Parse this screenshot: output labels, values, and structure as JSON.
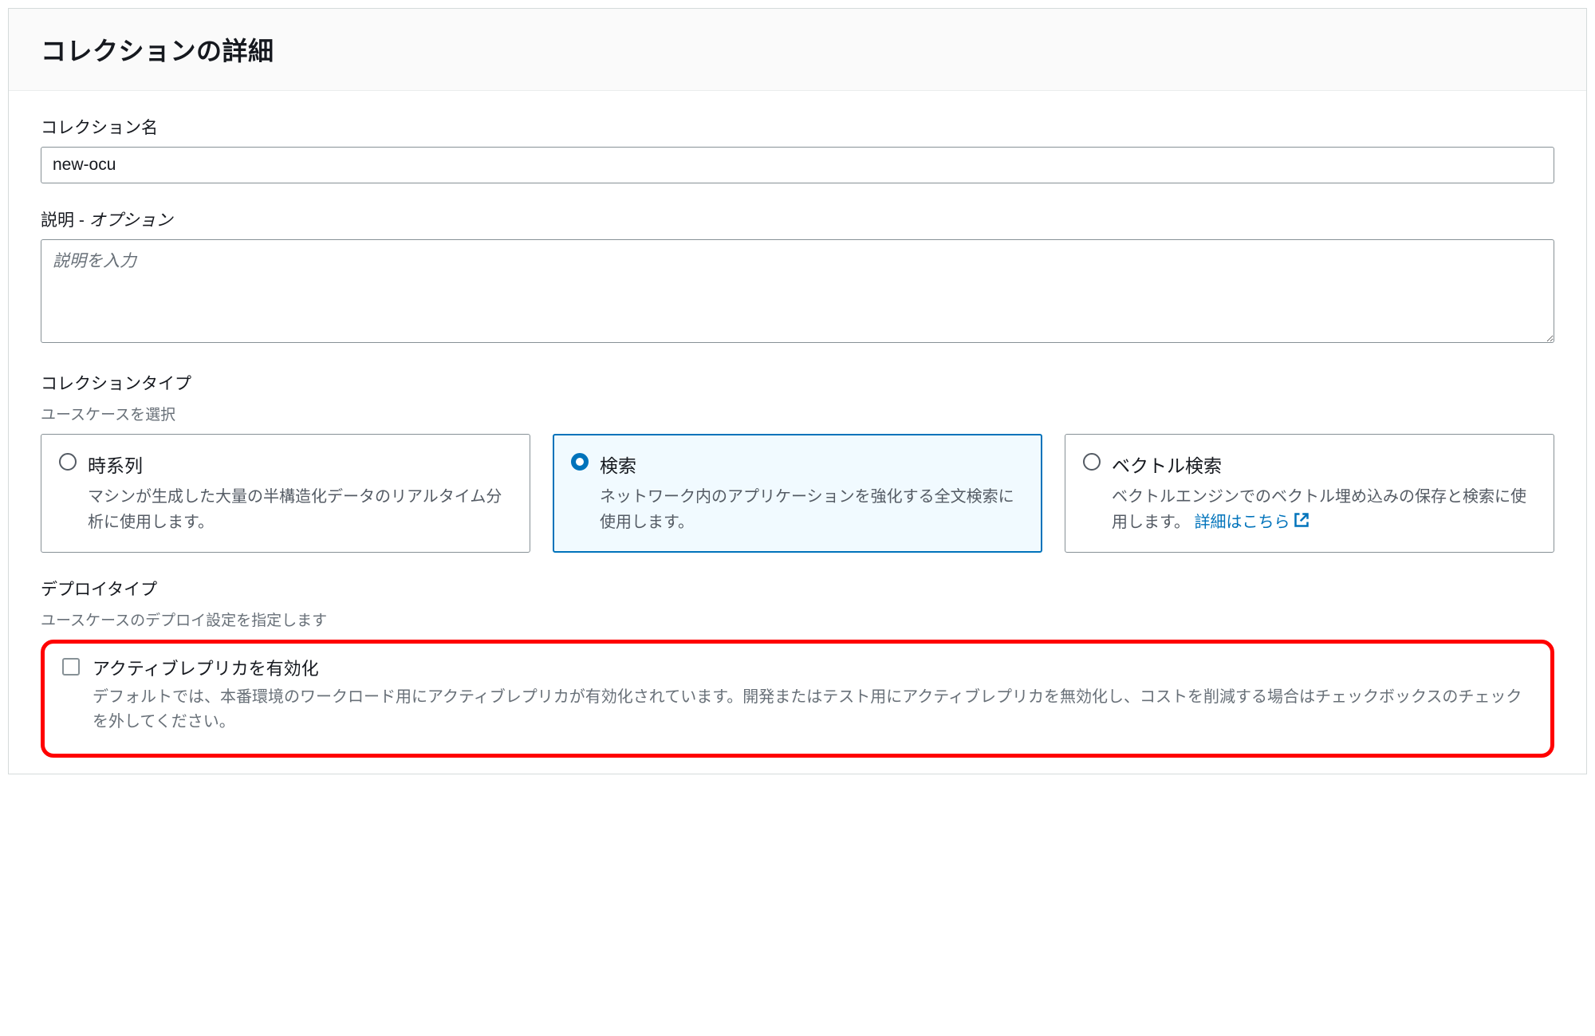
{
  "header": {
    "title": "コレクションの詳細"
  },
  "collectionName": {
    "label": "コレクション名",
    "value": "new-ocu"
  },
  "description": {
    "label": "説明 - ",
    "optional": "オプション",
    "placeholder": "説明を入力",
    "value": ""
  },
  "collectionType": {
    "label": "コレクションタイプ",
    "sublabel": "ユースケースを選択",
    "options": [
      {
        "title": "時系列",
        "desc": "マシンが生成した大量の半構造化データのリアルタイム分析に使用します。",
        "selected": false,
        "hasLink": false
      },
      {
        "title": "検索",
        "desc": "ネットワーク内のアプリケーションを強化する全文検索に使用します。",
        "selected": true,
        "hasLink": false
      },
      {
        "title": "ベクトル検索",
        "desc": "ベクトルエンジンでのベクトル埋め込みの保存と検索に使用します。 ",
        "link": "詳細はこちら",
        "selected": false,
        "hasLink": true
      }
    ]
  },
  "deployType": {
    "label": "デプロイタイプ",
    "sublabel": "ユースケースのデプロイ設定を指定します",
    "checkbox": {
      "title": "アクティブレプリカを有効化",
      "desc": "デフォルトでは、本番環境のワークロード用にアクティブレプリカが有効化されています。開発またはテスト用にアクティブレプリカを無効化し、コストを削減する場合はチェックボックスのチェックを外してください。",
      "checked": false
    }
  }
}
